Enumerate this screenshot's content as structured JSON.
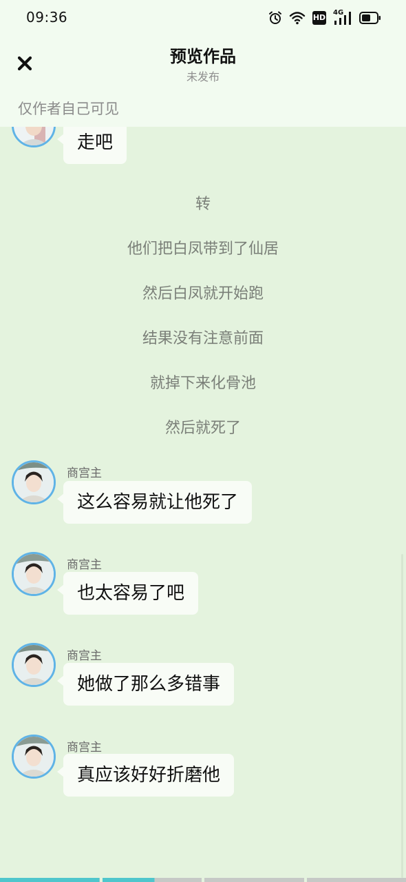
{
  "status_bar": {
    "time": "09:36",
    "hd_label": "HD",
    "network_label": "4G",
    "icons": [
      "alarm-icon",
      "wifi-icon",
      "hd-icon",
      "signal-icon",
      "battery-icon"
    ],
    "battery_level": 0.6
  },
  "header": {
    "title": "预览作品",
    "subtitle": "未发布",
    "close_icon": "close-icon"
  },
  "visibility_note": "仅作者自己可见",
  "messages": [
    {
      "type": "message",
      "sender": "",
      "text": "走吧"
    },
    {
      "type": "narration",
      "text": "转"
    },
    {
      "type": "narration",
      "text": "他们把白凤带到了仙居"
    },
    {
      "type": "narration",
      "text": "然后白凤就开始跑"
    },
    {
      "type": "narration",
      "text": "结果没有注意前面"
    },
    {
      "type": "narration",
      "text": "就掉下来化骨池"
    },
    {
      "type": "narration",
      "text": "然后就死了"
    },
    {
      "type": "message",
      "sender": "商宫主",
      "text": "这么容易就让他死了"
    },
    {
      "type": "message",
      "sender": "商宫主",
      "text": "也太容易了吧"
    },
    {
      "type": "message",
      "sender": "商宫主",
      "text": "她做了那么多错事"
    },
    {
      "type": "message",
      "sender": "商宫主",
      "text": "真应该好好折磨他"
    }
  ],
  "progress": {
    "segments": 4,
    "played_fraction": 0.38
  },
  "colors": {
    "background": "#e4f3de",
    "header_background": "#f2fbf0",
    "bubble": "#f8fcf6",
    "avatar_ring": "#5fb3e6",
    "progress_played": "#4fc6cc",
    "progress_remaining": "#c6c9c6"
  }
}
